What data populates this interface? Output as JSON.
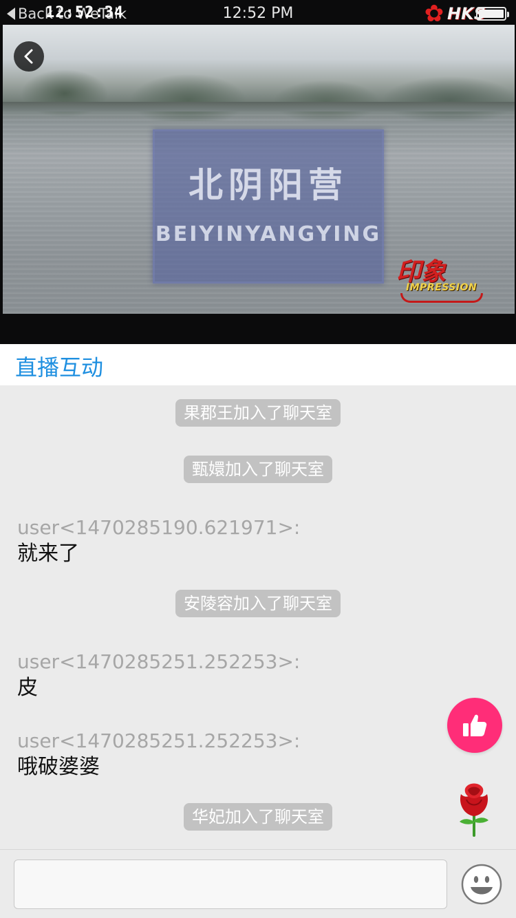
{
  "status_bar": {
    "back_label": "Back to WeTalk",
    "timestamp_overlay": "12:52:34",
    "time": "12:52 PM",
    "channel_logo": "HKS"
  },
  "video": {
    "sign_chinese": "北阴阳营",
    "sign_pinyin": "BEIYINYANGYING",
    "watermark_cn": "印象",
    "watermark_en": "IMPRESSION"
  },
  "section": {
    "title": "直播互动"
  },
  "colors": {
    "accent": "#1e8fe0",
    "like": "#ff2d78",
    "system_bubble": "#c2c2c2"
  },
  "chat": {
    "system_messages": [
      "果郡王加入了聊天室",
      "甄嬛加入了聊天室",
      "安陵容加入了聊天室",
      "华妃加入了聊天室"
    ],
    "user_messages": [
      {
        "user": "user<1470285190.621971>:",
        "text": "就来了"
      },
      {
        "user": "user<1470285251.252253>:",
        "text": "皮"
      },
      {
        "user": "user<1470285251.252253>:",
        "text": "哦破婆婆"
      }
    ]
  },
  "actions": {
    "like_icon": "thumbs-up-icon",
    "gift_icon": "rose-icon",
    "emoji_icon": "smiley-icon"
  },
  "input": {
    "value": "",
    "placeholder": ""
  }
}
